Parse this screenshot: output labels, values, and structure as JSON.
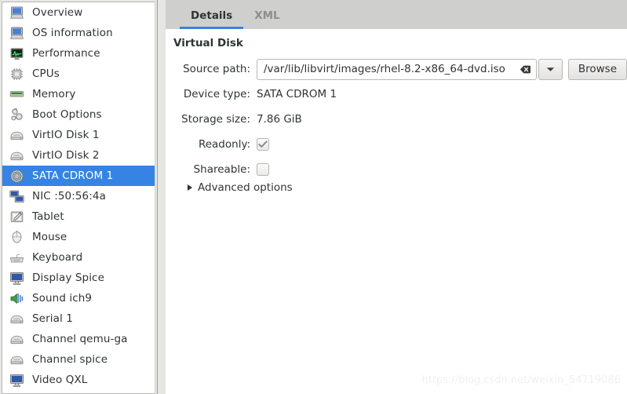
{
  "sidebar": {
    "items": [
      {
        "label": "Overview",
        "icon": "computer-icon",
        "selected": false
      },
      {
        "label": "OS information",
        "icon": "computer-icon",
        "selected": false
      },
      {
        "label": "Performance",
        "icon": "performance-icon",
        "selected": false
      },
      {
        "label": "CPUs",
        "icon": "cpu-chip-icon",
        "selected": false
      },
      {
        "label": "Memory",
        "icon": "memory-ram-icon",
        "selected": false
      },
      {
        "label": "Boot Options",
        "icon": "gears-icon",
        "selected": false
      },
      {
        "label": "VirtIO Disk 1",
        "icon": "harddisk-icon",
        "selected": false
      },
      {
        "label": "VirtIO Disk 2",
        "icon": "harddisk-icon",
        "selected": false
      },
      {
        "label": "SATA CDROM 1",
        "icon": "cdrom-disc-icon",
        "selected": true
      },
      {
        "label": "NIC :50:56:4a",
        "icon": "network-icon",
        "selected": false
      },
      {
        "label": "Tablet",
        "icon": "tablet-pen-icon",
        "selected": false
      },
      {
        "label": "Mouse",
        "icon": "mouse-icon",
        "selected": false
      },
      {
        "label": "Keyboard",
        "icon": "keyboard-icon",
        "selected": false
      },
      {
        "label": "Display Spice",
        "icon": "display-icon",
        "selected": false
      },
      {
        "label": "Sound ich9",
        "icon": "sound-icon",
        "selected": false
      },
      {
        "label": "Serial 1",
        "icon": "serial-port-icon",
        "selected": false
      },
      {
        "label": "Channel qemu-ga",
        "icon": "serial-port-icon",
        "selected": false
      },
      {
        "label": "Channel spice",
        "icon": "serial-port-icon",
        "selected": false
      },
      {
        "label": "Video QXL",
        "icon": "display-icon",
        "selected": false
      }
    ],
    "selected_color": "#3584e4"
  },
  "tabs": [
    {
      "label": "Details",
      "active": true
    },
    {
      "label": "XML",
      "active": false
    }
  ],
  "details": {
    "section_title": "Virtual Disk",
    "source_path": {
      "label": "Source path:",
      "value": "/var/lib/libvirt/images/rhel-8.2-x86_64-dvd.iso",
      "clear_icon": "clear-entry-icon",
      "dropdown_icon": "chevron-down-icon",
      "browse_label": "Browse"
    },
    "device_type": {
      "label": "Device type:",
      "value": "SATA CDROM 1"
    },
    "storage_size": {
      "label": "Storage size:",
      "value": "7.86 GiB"
    },
    "readonly": {
      "label": "Readonly:",
      "checked": true
    },
    "shareable": {
      "label": "Shareable:",
      "checked": false
    },
    "advanced_options": {
      "label": "Advanced options",
      "expanded": false
    }
  },
  "watermark": {
    "text": "https://blog.csdn.net/weixin_54719086"
  }
}
